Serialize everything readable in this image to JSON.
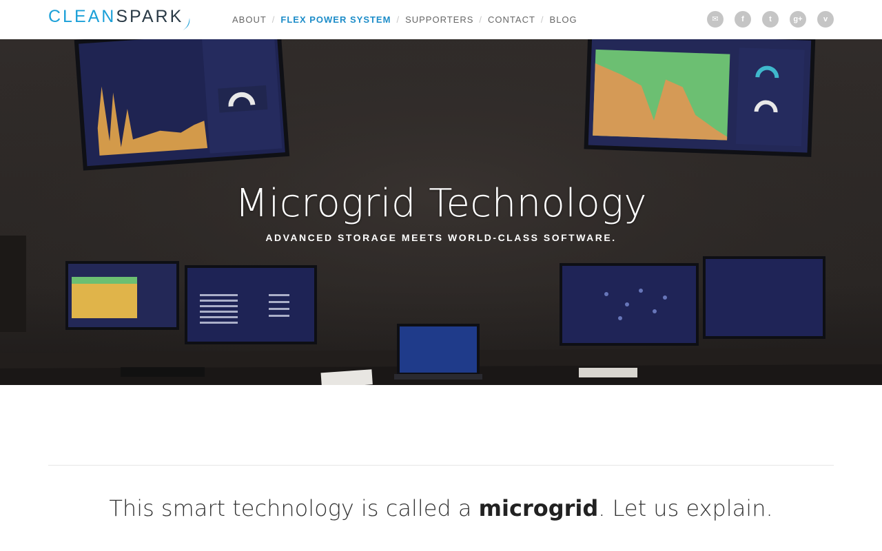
{
  "brand": {
    "name_part1": "CLEAN",
    "name_part2": "SPARK",
    "color_primary": "#1ba0d8",
    "color_secondary": "#2a3a46"
  },
  "nav": {
    "items": [
      {
        "label": "ABOUT",
        "active": false
      },
      {
        "label": "FLEX POWER SYSTEM",
        "active": true
      },
      {
        "label": "SUPPORTERS",
        "active": false
      },
      {
        "label": "CONTACT",
        "active": false
      },
      {
        "label": "BLOG",
        "active": false
      }
    ],
    "separator": "/",
    "active_color": "#1c8cc8"
  },
  "social": [
    {
      "icon": "mail-icon",
      "glyph": "✉"
    },
    {
      "icon": "facebook-icon",
      "glyph": "f"
    },
    {
      "icon": "twitter-icon",
      "glyph": "t"
    },
    {
      "icon": "google-plus-icon",
      "glyph": "g+"
    },
    {
      "icon": "vimeo-icon",
      "glyph": "v"
    }
  ],
  "hero": {
    "title": "Microgrid Technology",
    "subtitle": "ADVANCED STORAGE MEETS WORLD-CLASS SOFTWARE."
  },
  "intro": {
    "before": "This smart technology is called a ",
    "bold": "microgrid",
    "after": ". Let us explain."
  }
}
